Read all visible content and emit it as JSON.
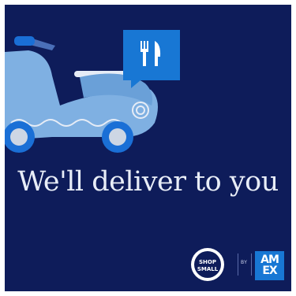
{
  "headline": "We'll deliver to you",
  "badge": {
    "line1": "SHOP",
    "line2": "SMALL"
  },
  "by_label": "BY",
  "amex": {
    "line1": "AM",
    "line2": "EX"
  },
  "colors": {
    "background": "#0e1c5a",
    "scooter_body": "#7fb0e2",
    "wheel": "#1a6fd6",
    "delivery_box": "#1877d4",
    "text": "#e8edf7"
  },
  "icons": [
    "scooter-illustration",
    "delivery-box",
    "fork-knife-icon",
    "shop-small-badge",
    "amex-logo"
  ]
}
